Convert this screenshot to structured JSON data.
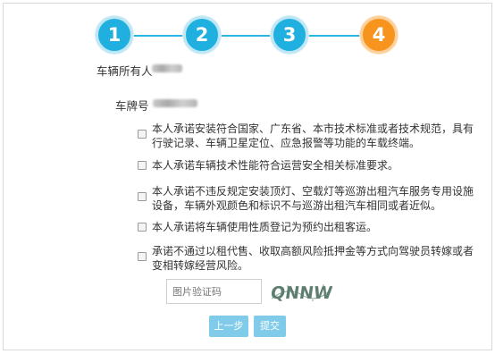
{
  "steps": [
    "1",
    "2",
    "3",
    "4"
  ],
  "active_step": "4",
  "fields": {
    "owner_label": "车辆所有人",
    "plate_label": "车牌号"
  },
  "commitments": [
    "本人承诺安装符合国家、广东省、本市技术标准或者技术规范，具有行驶记录、车辆卫星定位、应急报警等功能的车载终端。",
    "本人承诺车辆技术性能符合运营安全相关标准要求。",
    "本人承诺不违反规定安装顶灯、空载灯等巡游出租汽车服务专用设施设备，车辆外观颜色和标识不与巡游出租汽车相同或者近似。",
    "本人承诺将车辆使用性质登记为预约出租客运。",
    "承诺不通过以租代售、收取高额风险抵押金等方式向驾驶员转嫁或者变相转嫁经营风险。"
  ],
  "captcha": {
    "placeholder": "图片验证码",
    "image_text": "QNNW"
  },
  "buttons": {
    "prev": "上一步",
    "submit": "提交"
  },
  "colors": {
    "step_blue": "#1fb0e0",
    "step_active": "#f7941d",
    "button": "#7fcbe9"
  }
}
